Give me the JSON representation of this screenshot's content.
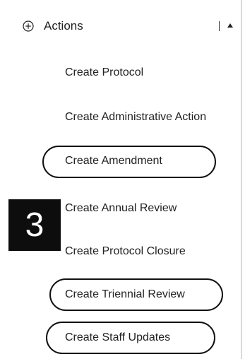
{
  "actions_panel": {
    "header": {
      "label": "Actions",
      "expand_icon": "plus-circle-icon",
      "collapse_icon": "caret-up-icon"
    },
    "items": [
      {
        "label": "Create Protocol",
        "highlighted": false
      },
      {
        "label": "Create Administrative Action",
        "highlighted": false
      },
      {
        "label": "Create Amendment",
        "highlighted": true
      },
      {
        "label": "Create Annual Review",
        "highlighted": false
      },
      {
        "label": "Create Protocol Closure",
        "highlighted": false
      },
      {
        "label": "Create Triennial Review",
        "highlighted": true
      },
      {
        "label": "Create Staff Updates",
        "highlighted": true
      }
    ]
  },
  "step_badge": {
    "label": "3"
  }
}
